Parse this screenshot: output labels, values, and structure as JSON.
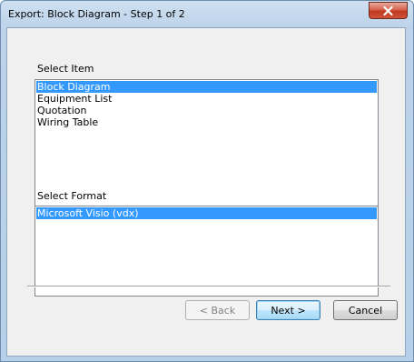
{
  "window": {
    "title": "Export: Block Diagram - Step 1 of 2"
  },
  "select_item": {
    "label": "Select Item",
    "items": [
      "Block Diagram",
      "Equipment List",
      "Quotation",
      "Wiring Table"
    ],
    "selected_index": 0
  },
  "select_format": {
    "label": "Select Format",
    "items": [
      "Microsoft Visio (vdx)"
    ],
    "selected_index": 0
  },
  "buttons": {
    "back": "< Back",
    "next": "Next >",
    "cancel": "Cancel"
  },
  "icons": {
    "close": "close-icon"
  },
  "colors": {
    "selection": "#3399ff",
    "close_button": "#c0391f"
  }
}
